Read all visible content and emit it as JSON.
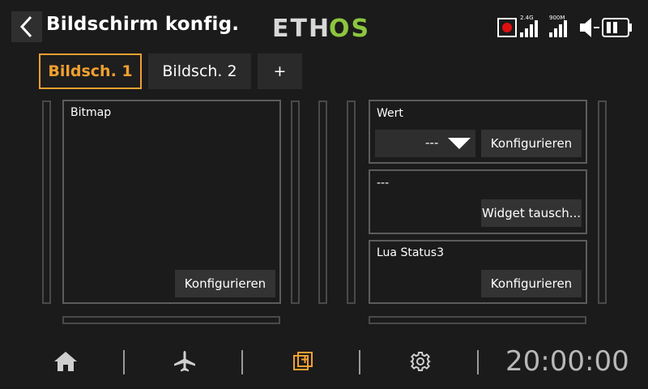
{
  "header": {
    "title": "Bildschirm konfig.",
    "logo_text": "ETHOS",
    "status": {
      "band_24": "2.4G",
      "band_900": "900M",
      "record_color": "#e01010"
    }
  },
  "tabs": [
    {
      "label": "Bildsch. 1",
      "active": true
    },
    {
      "label": "Bildsch. 2",
      "active": false
    },
    {
      "label": "+",
      "active": false
    }
  ],
  "widgets": {
    "bitmap": {
      "label": "Bitmap",
      "button": "Konfigurieren"
    },
    "wert": {
      "label": "Wert",
      "select_value": "---",
      "button": "Konfigurieren"
    },
    "empty": {
      "label": "---",
      "button": "Widget tausch..."
    },
    "lua": {
      "label": "Lua Status3",
      "button": "Konfigurieren"
    }
  },
  "bottom_nav": {
    "items": [
      "home-icon",
      "airplane-icon",
      "screens-icon",
      "settings-icon"
    ],
    "active": "screens-icon",
    "clock": "20:00:00"
  },
  "colors": {
    "accent": "#f0a030",
    "logo_green": "#8cc63f",
    "background": "#1b1b1b"
  }
}
